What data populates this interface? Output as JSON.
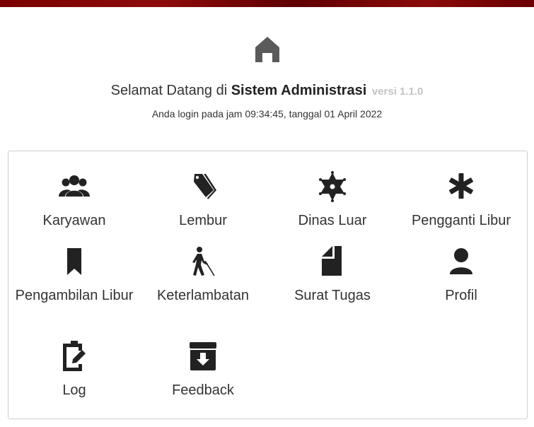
{
  "header": {
    "welcome_prefix": "Selamat Datang di",
    "app_name": "Sistem Administrasi",
    "version": "versi 1.1.0",
    "login_info": "Anda login pada jam 09:34:45, tanggal 01 April 2022"
  },
  "menu": [
    {
      "label": "Karyawan",
      "icon": "users-icon"
    },
    {
      "label": "Lembur",
      "icon": "tags-icon"
    },
    {
      "label": "Dinas Luar",
      "icon": "sheriff-star-icon"
    },
    {
      "label": "Pengganti Libur",
      "icon": "asterisk-icon"
    },
    {
      "label": "Pengambilan Libur",
      "icon": "bookmark-icon"
    },
    {
      "label": "Keterlambatan",
      "icon": "blind-walking-icon"
    },
    {
      "label": "Surat Tugas",
      "icon": "document-icon"
    },
    {
      "label": "Profil",
      "icon": "user-icon"
    },
    {
      "label": "Log",
      "icon": "clipboard-edit-icon"
    },
    {
      "label": "Feedback",
      "icon": "archive-download-icon"
    }
  ],
  "colors": {
    "accent": "#8b0000",
    "icon": "#222222",
    "home_icon": "#555555",
    "version": "#c4c4c4"
  }
}
